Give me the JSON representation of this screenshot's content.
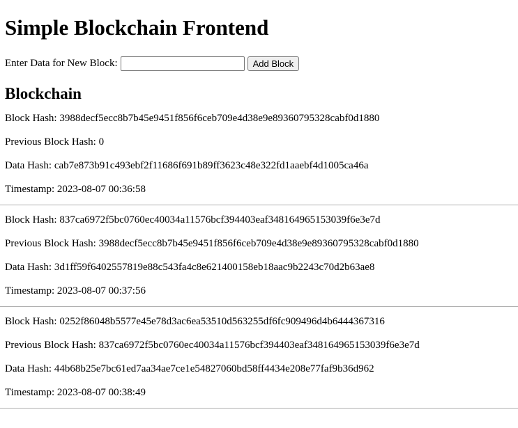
{
  "page": {
    "title": "Simple Blockchain Frontend"
  },
  "form": {
    "label": "Enter Data for New Block:",
    "input_value": "",
    "button_label": "Add Block"
  },
  "chain": {
    "heading": "Blockchain",
    "labels": {
      "hash": "Block Hash:",
      "previous": "Previous Block Hash:",
      "data": "Data Hash:",
      "timestamp": "Timestamp:"
    },
    "blocks": [
      {
        "hash": "3988decf5ecc8b7b45e9451f856f6ceb709e4d38e9e89360795328cabf0d1880",
        "previous": "0",
        "data": "cab7e873b91c493ebf2f11686f691b89ff3623c48e322fd1aaebf4d1005ca46a",
        "timestamp": "2023-08-07 00:36:58"
      },
      {
        "hash": "837ca6972f5bc0760ec40034a11576bcf394403eaf348164965153039f6e3e7d",
        "previous": "3988decf5ecc8b7b45e9451f856f6ceb709e4d38e9e89360795328cabf0d1880",
        "data": "3d1ff59f6402557819e88c543fa4c8e621400158eb18aac9b2243c70d2b63ae8",
        "timestamp": "2023-08-07 00:37:56"
      },
      {
        "hash": "0252f86048b5577e45e78d3ac6ea53510d563255df6fc909496d4b6444367316",
        "previous": "837ca6972f5bc0760ec40034a11576bcf394403eaf348164965153039f6e3e7d",
        "data": "44b68b25e7bc61ed7aa34ae7ce1e54827060bd58ff4434e208e77faf9b36d962",
        "timestamp": "2023-08-07 00:38:49"
      }
    ]
  }
}
